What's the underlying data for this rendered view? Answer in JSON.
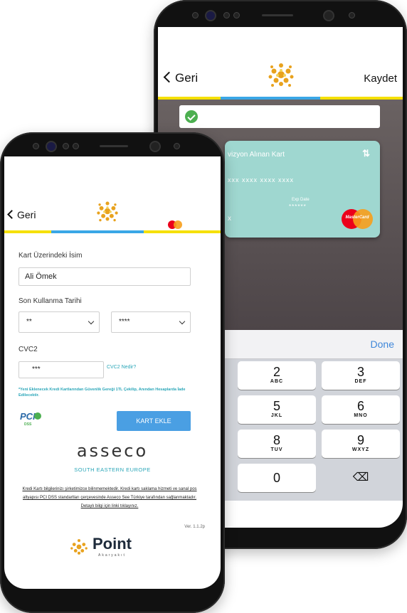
{
  "back_screen": {
    "nav": {
      "back_label": "Geri",
      "save_label": "Kaydet"
    },
    "card": {
      "title": "vizyon Alınan Kart",
      "number": "xxx  xxxx  xxxx  xxxx",
      "exp_label": "Exp Date",
      "exp_value": "******",
      "brand_text": "MasterCard",
      "left_mark": "x"
    },
    "keyboard": {
      "done_label": "Done",
      "keys": [
        {
          "num": "2",
          "letters": "ABC"
        },
        {
          "num": "3",
          "letters": "DEF"
        },
        {
          "num": "5",
          "letters": "JKL"
        },
        {
          "num": "6",
          "letters": "MNO"
        },
        {
          "num": "8",
          "letters": "TUV"
        },
        {
          "num": "9",
          "letters": "WXYZ"
        },
        {
          "num": "0",
          "letters": ""
        }
      ],
      "delete_symbol": "⌫"
    }
  },
  "front_screen": {
    "nav": {
      "back_label": "Geri"
    },
    "form": {
      "name_label": "Kart Üzerindeki İsim",
      "name_value": "Ali Ömek",
      "expiry_label": "Son Kullanma Tarihi",
      "month_value": "**",
      "year_value": "****",
      "cvc_label": "CVC2",
      "cvc_value": "***",
      "cvc_help_link": "CVC2 Nedir?",
      "note": "*Yeni Eklenecek Kredi Kartlarından Güvenlik Gereği 1TL Çekilip, Anından Hesaplarda İade Edilecektir.",
      "add_card_button": "KART EKLE",
      "pci_badge": "PCI",
      "pci_sub": "DSS"
    },
    "sponsor": {
      "name": "asseco",
      "subtitle": "SOUTH EASTERN EUROPE",
      "disclaimer": "Kredi Kartı bilgilerinizı şirketimizce bilinmemektedir. Kredi kartı saklama hizmeti ve sanal pos altyapısı PCI DSS standartları çerçevesinde Asseco See Türkiye tarafından sağlanmaktadır. Detaylı bilgi için linki tıklayınız.",
      "version": "Ver. 1.1.2p"
    },
    "brand": {
      "name": "Point",
      "tagline": "Akaryakıt"
    }
  },
  "colors": {
    "yellow": "#f5e000",
    "blue": "#3aa7e6",
    "button": "#4a9fe3",
    "card": "#9fd7d0",
    "green": "#4caf50",
    "teal_text": "#2aa6b8"
  }
}
